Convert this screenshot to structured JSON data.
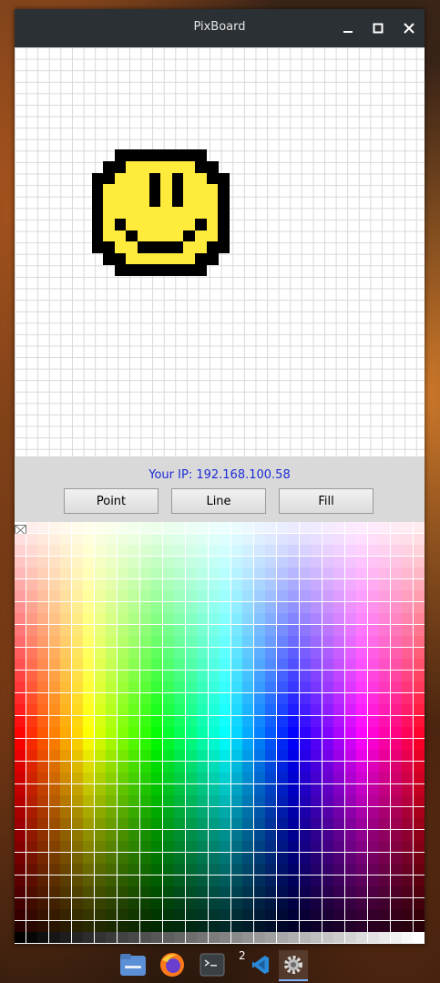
{
  "window": {
    "title": "PixBoard",
    "controls": {
      "minimize_icon": "minimize-icon",
      "maximize_icon": "maximize-icon",
      "close_icon": "close-icon"
    }
  },
  "canvas": {
    "colors": {
      "black": "#000000",
      "yellow": "#ffeb3b"
    }
  },
  "controls": {
    "ip_text": "Your IP: 192.168.100.58",
    "buttons": [
      {
        "label": "Point"
      },
      {
        "label": "Line"
      },
      {
        "label": "Fill"
      }
    ]
  },
  "palette": {
    "first_swatch": "transparent-eraser"
  },
  "taskbar": {
    "items": [
      {
        "icon": "file-manager-icon"
      },
      {
        "icon": "firefox-icon"
      },
      {
        "icon": "terminal-icon"
      },
      {
        "icon": "vscode-icon",
        "badge": "2"
      },
      {
        "icon": "settings-icon"
      }
    ]
  }
}
